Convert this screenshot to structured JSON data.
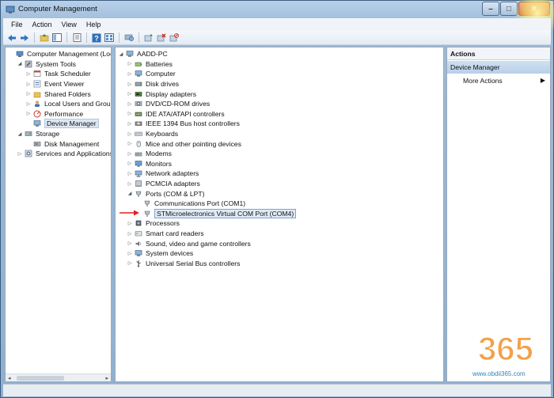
{
  "window": {
    "title": "Computer Management",
    "buttons": {
      "minimize": "–",
      "maximize": "□",
      "close": "✕"
    }
  },
  "menu": [
    "File",
    "Action",
    "View",
    "Help"
  ],
  "left_tree": [
    {
      "label": "Computer Management (Local",
      "level": 0,
      "exp": "",
      "icon": "computer-management-icon"
    },
    {
      "label": "System Tools",
      "level": 1,
      "exp": "◢",
      "icon": "system-tools-icon"
    },
    {
      "label": "Task Scheduler",
      "level": 2,
      "exp": "▷",
      "icon": "task-scheduler-icon"
    },
    {
      "label": "Event Viewer",
      "level": 2,
      "exp": "▷",
      "icon": "event-viewer-icon"
    },
    {
      "label": "Shared Folders",
      "level": 2,
      "exp": "▷",
      "icon": "shared-folders-icon"
    },
    {
      "label": "Local Users and Groups",
      "level": 2,
      "exp": "▷",
      "icon": "local-users-icon"
    },
    {
      "label": "Performance",
      "level": 2,
      "exp": "▷",
      "icon": "performance-icon"
    },
    {
      "label": "Device Manager",
      "level": 2,
      "exp": "",
      "icon": "device-manager-icon",
      "selected": true
    },
    {
      "label": "Storage",
      "level": 1,
      "exp": "◢",
      "icon": "storage-icon"
    },
    {
      "label": "Disk Management",
      "level": 2,
      "exp": "",
      "icon": "disk-management-icon"
    },
    {
      "label": "Services and Applications",
      "level": 1,
      "exp": "▷",
      "icon": "services-icon"
    }
  ],
  "device_tree": [
    {
      "label": "AADD-PC",
      "level": 0,
      "exp": "◢",
      "icon": "computer-icon"
    },
    {
      "label": "Batteries",
      "level": 1,
      "exp": "▷",
      "icon": "battery-icon"
    },
    {
      "label": "Computer",
      "level": 1,
      "exp": "▷",
      "icon": "computer-icon"
    },
    {
      "label": "Disk drives",
      "level": 1,
      "exp": "▷",
      "icon": "disk-drive-icon"
    },
    {
      "label": "Display adapters",
      "level": 1,
      "exp": "▷",
      "icon": "display-adapter-icon"
    },
    {
      "label": "DVD/CD-ROM drives",
      "level": 1,
      "exp": "▷",
      "icon": "dvd-icon"
    },
    {
      "label": "IDE ATA/ATAPI controllers",
      "level": 1,
      "exp": "▷",
      "icon": "ide-controller-icon"
    },
    {
      "label": "IEEE 1394 Bus host controllers",
      "level": 1,
      "exp": "▷",
      "icon": "ieee1394-icon"
    },
    {
      "label": "Keyboards",
      "level": 1,
      "exp": "▷",
      "icon": "keyboard-icon"
    },
    {
      "label": "Mice and other pointing devices",
      "level": 1,
      "exp": "▷",
      "icon": "mouse-icon"
    },
    {
      "label": "Modems",
      "level": 1,
      "exp": "▷",
      "icon": "modem-icon"
    },
    {
      "label": "Monitors",
      "level": 1,
      "exp": "▷",
      "icon": "monitor-icon"
    },
    {
      "label": "Network adapters",
      "level": 1,
      "exp": "▷",
      "icon": "network-adapter-icon"
    },
    {
      "label": "PCMCIA adapters",
      "level": 1,
      "exp": "▷",
      "icon": "pcmcia-icon"
    },
    {
      "label": "Ports (COM & LPT)",
      "level": 1,
      "exp": "◢",
      "icon": "port-icon"
    },
    {
      "label": "Communications Port (COM1)",
      "level": 2,
      "exp": "",
      "icon": "port-icon"
    },
    {
      "label": "STMicroelectronics Virtual COM Port (COM4)",
      "level": 2,
      "exp": "",
      "icon": "port-icon",
      "highlighted": true
    },
    {
      "label": "Processors",
      "level": 1,
      "exp": "▷",
      "icon": "processor-icon"
    },
    {
      "label": "Smart card readers",
      "level": 1,
      "exp": "▷",
      "icon": "smart-card-icon"
    },
    {
      "label": "Sound, video and game controllers",
      "level": 1,
      "exp": "▷",
      "icon": "sound-icon"
    },
    {
      "label": "System devices",
      "level": 1,
      "exp": "▷",
      "icon": "system-device-icon"
    },
    {
      "label": "Universal Serial Bus controllers",
      "level": 1,
      "exp": "▷",
      "icon": "usb-icon"
    }
  ],
  "actions": {
    "header": "Actions",
    "section": "Device Manager",
    "more": "More Actions",
    "more_arrow": "▶"
  },
  "watermark": {
    "digits": "365",
    "url": "www.obdii365.com"
  },
  "colors": {
    "selection": "#dde7f3",
    "highlight_border": "#7ea3cc",
    "red_arrow": "#e02020",
    "watermark_orange": "#f08a1c",
    "watermark_blue": "#2e86c1"
  }
}
